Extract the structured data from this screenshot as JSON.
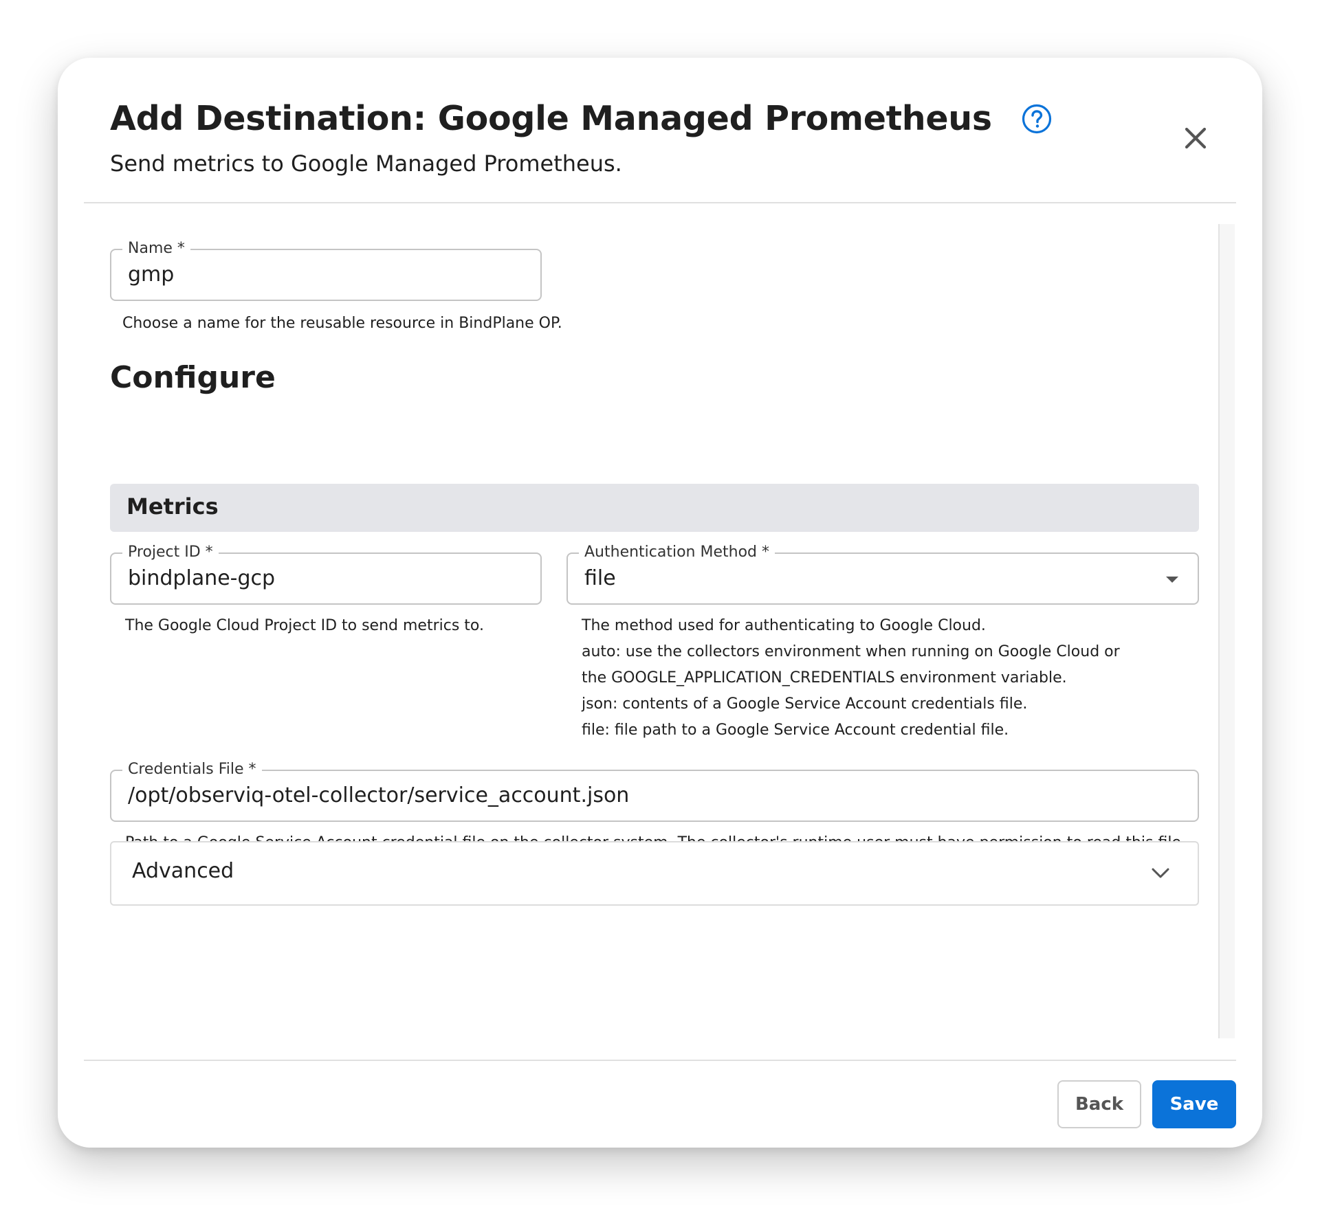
{
  "dialog": {
    "title": "Add Destination: Google Managed Prometheus",
    "subtitle": "Send metrics to Google Managed Prometheus.",
    "help_icon": "help-circle-icon",
    "close_icon": "close-icon"
  },
  "name_field": {
    "label": "Name *",
    "value": "gmp",
    "helper": "Choose a name for the reusable resource in BindPlane OP."
  },
  "configure": {
    "title": "Configure",
    "section": "Metrics",
    "project_id": {
      "label": "Project ID *",
      "value": "bindplane-gcp",
      "helper": "The Google Cloud Project ID to send metrics to."
    },
    "auth_method": {
      "label": "Authentication Method *",
      "value": "file",
      "helper_lines": [
        "The method used for authenticating to Google Cloud.",
        "auto: use the collectors environment when running on Google Cloud or",
        "the GOOGLE_APPLICATION_CREDENTIALS environment variable.",
        "json: contents of a Google Service Account credentials file.",
        "file: file path to a Google Service Account credential file."
      ]
    },
    "credentials_file": {
      "label": "Credentials File *",
      "value": "/opt/observiq-otel-collector/service_account.json",
      "helper": "Path to a Google Service Account credential file on the collector system. The collector's runtime user must have permission to read this file."
    },
    "advanced": {
      "label": "Advanced"
    }
  },
  "footer": {
    "back_label": "Back",
    "save_label": "Save"
  },
  "colors": {
    "accent": "#0b73d9",
    "section_bg": "#e4e5e9",
    "border": "#c4c4c4"
  }
}
